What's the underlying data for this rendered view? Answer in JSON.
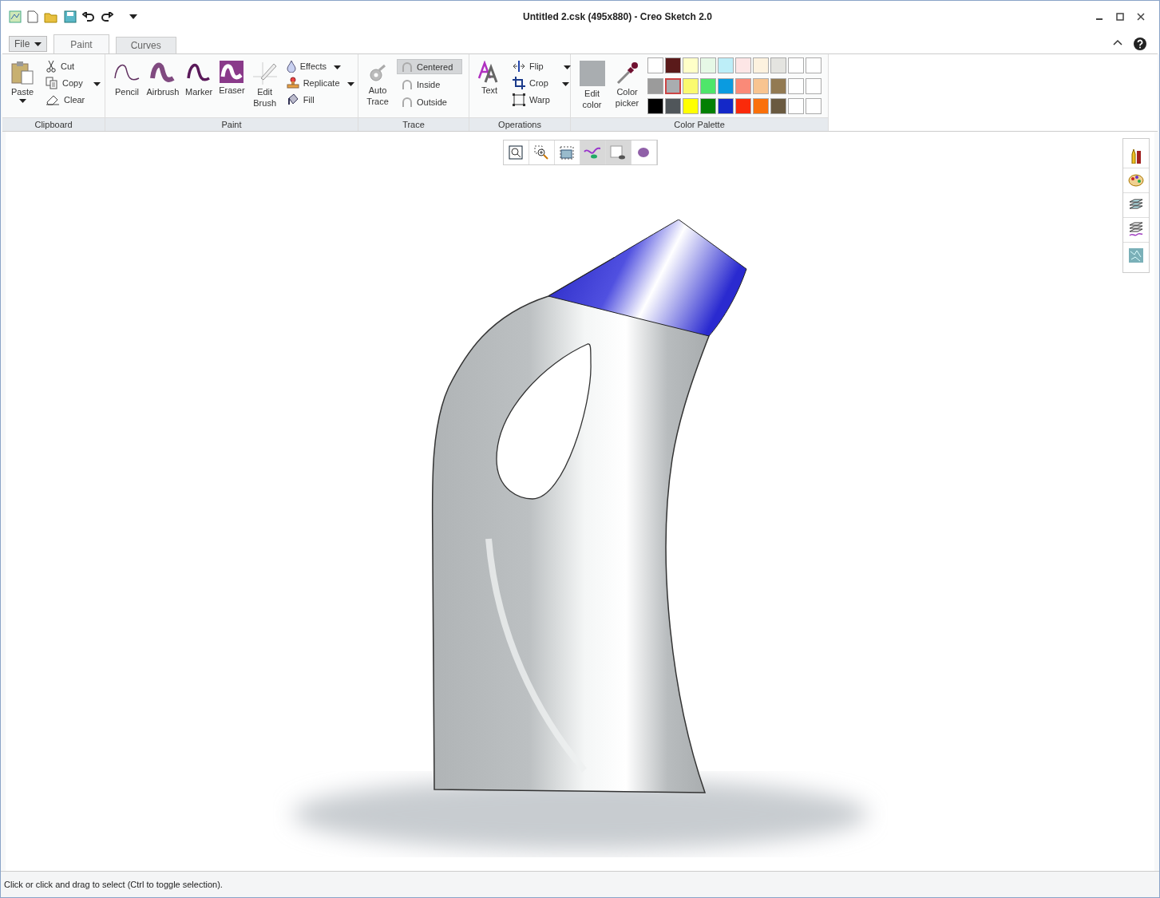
{
  "window": {
    "title": "Untitled 2.csk (495x880) - Creo Sketch 2.0"
  },
  "menu": {
    "file": "File"
  },
  "tabs": [
    {
      "label": "Paint",
      "selected": true
    },
    {
      "label": "Curves",
      "selected": false
    }
  ],
  "ribbon": {
    "clipboard": {
      "label": "Clipboard",
      "paste": "Paste",
      "items": [
        {
          "kind": "cut",
          "label": "Cut"
        },
        {
          "kind": "copy",
          "label": "Copy"
        },
        {
          "kind": "clear",
          "label": "Clear"
        }
      ]
    },
    "paint": {
      "label": "Paint",
      "tools": [
        {
          "kind": "pencil",
          "label": "Pencil"
        },
        {
          "kind": "airbrush",
          "label": "Airbrush"
        },
        {
          "kind": "marker",
          "label": "Marker"
        },
        {
          "kind": "eraser",
          "label": "Eraser"
        },
        {
          "kind": "edit",
          "label": "Edit Brush"
        }
      ],
      "items": [
        {
          "kind": "effects",
          "label": "Effects"
        },
        {
          "kind": "replicate",
          "label": "Replicate"
        },
        {
          "kind": "fill",
          "label": "Fill"
        }
      ]
    },
    "trace": {
      "label": "Trace",
      "auto": "Auto Trace",
      "options": [
        {
          "label": "Centered",
          "selected": true
        },
        {
          "label": "Inside",
          "selected": false
        },
        {
          "label": "Outside",
          "selected": false
        }
      ]
    },
    "operations": {
      "label": "Operations",
      "text": "Text",
      "items": [
        {
          "kind": "flip",
          "label": "Flip"
        },
        {
          "kind": "crop",
          "label": "Crop"
        },
        {
          "kind": "warp",
          "label": "Warp"
        }
      ]
    },
    "palette": {
      "label": "Color Palette",
      "edit_color": "Edit color",
      "picker": "Color picker",
      "swatches": [
        {
          "color": "#ffffff",
          "selected": false
        },
        {
          "color": "#5a1a1a",
          "selected": false
        },
        {
          "color": "#ffffc8",
          "selected": false
        },
        {
          "color": "#e6f8e6",
          "selected": false
        },
        {
          "color": "#bdeef8",
          "selected": false
        },
        {
          "color": "#fde6e6",
          "selected": false
        },
        {
          "color": "#fdf2df",
          "selected": false
        },
        {
          "color": "#e4e4e0",
          "selected": false
        },
        {
          "color": "#ffffff",
          "selected": false
        },
        {
          "color": "#ffffff",
          "selected": false
        },
        {
          "color": "#9b9b9b",
          "selected": false
        },
        {
          "color": "#a9adb0",
          "selected": true
        },
        {
          "color": "#fafa6e",
          "selected": false
        },
        {
          "color": "#4ee66a",
          "selected": false
        },
        {
          "color": "#0a9be0",
          "selected": false
        },
        {
          "color": "#fa8a78",
          "selected": false
        },
        {
          "color": "#f8c490",
          "selected": false
        },
        {
          "color": "#927a52",
          "selected": false
        },
        {
          "color": "#ffffff",
          "selected": false
        },
        {
          "color": "#ffffff",
          "selected": false
        },
        {
          "color": "#000000",
          "selected": false
        },
        {
          "color": "#50565a",
          "selected": false
        },
        {
          "color": "#ffff00",
          "selected": false
        },
        {
          "color": "#048004",
          "selected": false
        },
        {
          "color": "#1428c8",
          "selected": false
        },
        {
          "color": "#fa2a0a",
          "selected": false
        },
        {
          "color": "#fa700a",
          "selected": false
        },
        {
          "color": "#6a5a40",
          "selected": false
        },
        {
          "color": "#ffffff",
          "selected": false
        },
        {
          "color": "#ffffff",
          "selected": false
        }
      ]
    }
  },
  "view_toolbar": [
    {
      "kind": "zoom-fit",
      "on": false
    },
    {
      "kind": "zoom-area",
      "on": false
    },
    {
      "kind": "pan",
      "on": false
    },
    {
      "kind": "curves",
      "on": true
    },
    {
      "kind": "canvas",
      "on": true
    },
    {
      "kind": "shape",
      "on": false
    }
  ],
  "status_bar": "Click or click and drag to select (Ctrl to toggle selection)."
}
